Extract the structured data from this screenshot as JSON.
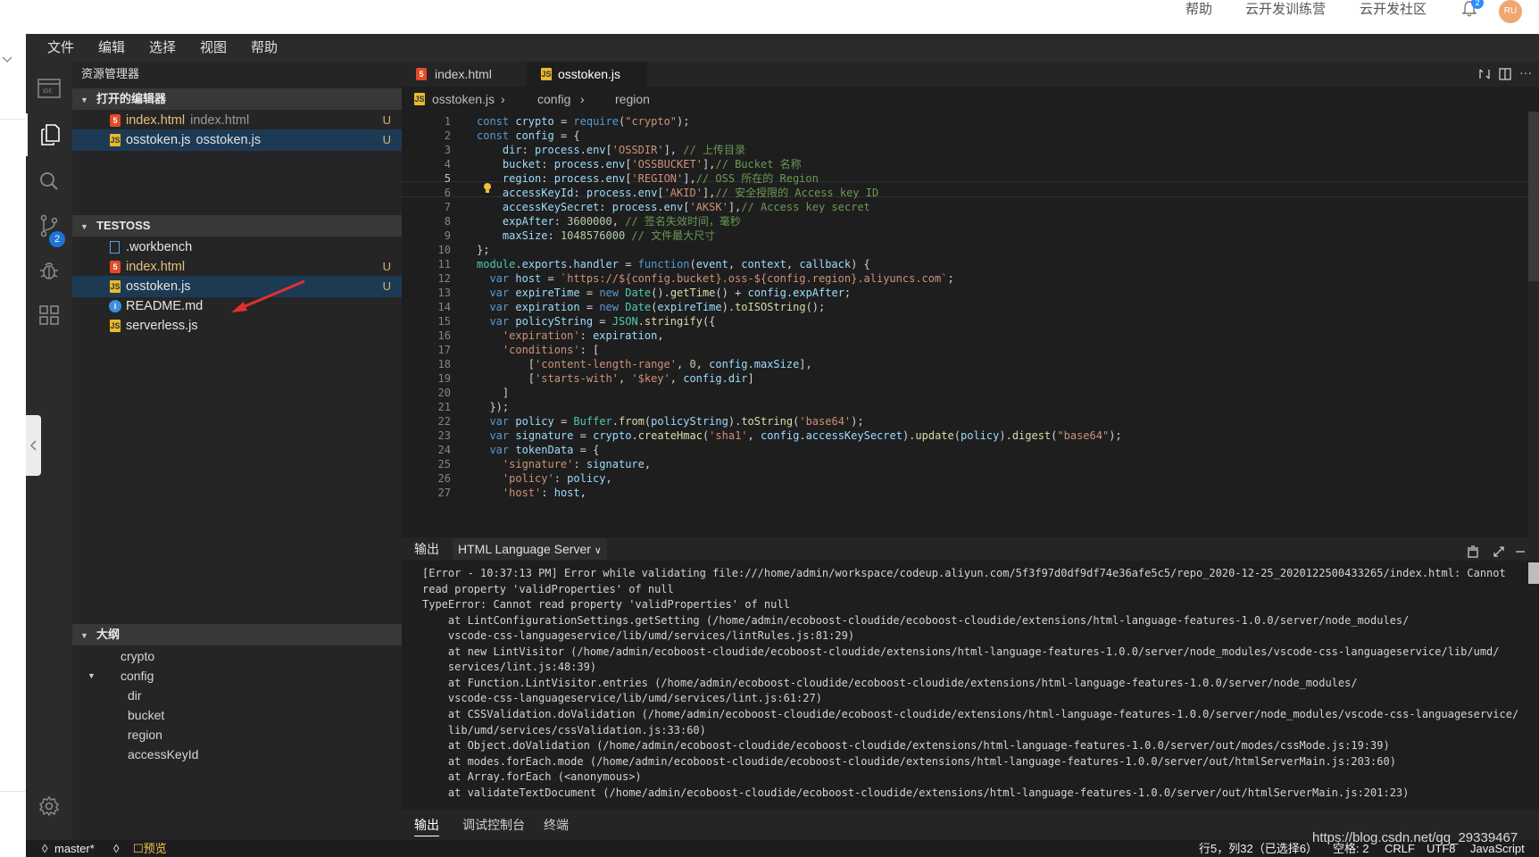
{
  "top_header": {
    "links": [
      "帮助",
      "云开发训练营",
      "云开发社区"
    ],
    "notification_count": "2",
    "avatar_initials": "RU"
  },
  "menubar": {
    "items": [
      "文件",
      "编辑",
      "选择",
      "视图",
      "帮助"
    ]
  },
  "activity_bar": {
    "icons": [
      "ide-logo-icon",
      "explorer-icon",
      "search-icon",
      "source-control-icon",
      "debug-icon",
      "extensions-icon",
      "settings-icon"
    ],
    "scm_badge": "2"
  },
  "sidebar": {
    "title": "资源管理器",
    "open_editors": {
      "header": "打开的编辑器",
      "items": [
        {
          "name": "index.html",
          "desc": "index.html",
          "badge": "U"
        },
        {
          "name": "osstoken.js",
          "desc": "osstoken.js",
          "badge": "U"
        }
      ]
    },
    "workspace": {
      "header": "TESTOSS",
      "items": [
        {
          "name": ".workbench",
          "badge": ""
        },
        {
          "name": "index.html",
          "badge": "U"
        },
        {
          "name": "osstoken.js",
          "badge": "U"
        },
        {
          "name": "README.md",
          "badge": ""
        },
        {
          "name": "serverless.js",
          "badge": ""
        }
      ]
    },
    "outline": {
      "header": "大纲",
      "items": [
        "crypto",
        "config",
        "dir",
        "bucket",
        "region",
        "accessKeyId"
      ]
    }
  },
  "editor": {
    "tabs": [
      "index.html",
      "osstoken.js"
    ],
    "active_tab": "osstoken.js",
    "breadcrumb": [
      "osstoken.js",
      "config",
      "region"
    ],
    "line_numbers": [
      "1",
      "2",
      "3",
      "4",
      "5",
      "6",
      "7",
      "8",
      "9",
      "10",
      "11",
      "12",
      "13",
      "14",
      "15",
      "16",
      "17",
      "18",
      "19",
      "20",
      "21",
      "22",
      "23",
      "24",
      "25",
      "26",
      "27"
    ],
    "code": [
      "const crypto = require(\"crypto\");",
      "const config = {",
      "    dir: process.env['OSSDIR'], // 上传目录",
      "    bucket: process.env['OSSBUCKET'],// Bucket 名称",
      "    region: process.env['REGION'],// OSS 所在的 Region",
      "    accessKeyId: process.env['AKID'],// 安全授限的 Access key ID",
      "    accessKeySecret: process.env['AKSK'],// Access key secret",
      "    expAfter: 3600000, // 签名失效时间，毫秒",
      "    maxSize: 1048576000 // 文件最大尺寸",
      "};",
      "module.exports.handler = function(event, context, callback) {",
      "  var host = `https://${config.bucket}.oss-${config.region}.aliyuncs.com`;",
      "  var expireTime = new Date().getTime() + config.expAfter;",
      "  var expiration = new Date(expireTime).toISOString();",
      "  var policyString = JSON.stringify({",
      "    'expiration': expiration,",
      "    'conditions': [",
      "        ['content-length-range', 0, config.maxSize],",
      "        ['starts-with', '$key', config.dir]",
      "    ]",
      "  });",
      "  var policy = Buffer.from(policyString).toString('base64');",
      "  var signature = crypto.createHmac('sha1', config.accessKeySecret).update(policy).digest(\"base64\");",
      "  var tokenData = {",
      "    'signature': signature,",
      "    'policy': policy,",
      "    'host': host,"
    ],
    "cursor_line": "5"
  },
  "panel": {
    "title": "输出",
    "channel": "HTML Language Server",
    "output_lines": [
      "[Error - 10:37:13 PM] Error while validating file:///home/admin/workspace/codeup.aliyun.com/5f3f97d0df9df74e36afe5c5/repo_2020-12-25_2020122500433265/index.html: Cannot",
      "read property 'validProperties' of null",
      "TypeError: Cannot read property 'validProperties' of null",
      "    at LintConfigurationSettings.getSetting (/home/admin/ecoboost-cloudide/ecoboost-cloudide/extensions/html-language-features-1.0.0/server/node_modules/",
      "    vscode-css-languageservice/lib/umd/services/lintRules.js:81:29)",
      "    at new LintVisitor (/home/admin/ecoboost-cloudide/ecoboost-cloudide/extensions/html-language-features-1.0.0/server/node_modules/vscode-css-languageservice/lib/umd/",
      "    services/lint.js:48:39)",
      "    at Function.LintVisitor.entries (/home/admin/ecoboost-cloudide/ecoboost-cloudide/extensions/html-language-features-1.0.0/server/node_modules/",
      "    vscode-css-languageservice/lib/umd/services/lint.js:61:27)",
      "    at CSSValidation.doValidation (/home/admin/ecoboost-cloudide/ecoboost-cloudide/extensions/html-language-features-1.0.0/server/node_modules/vscode-css-languageservice/",
      "    lib/umd/services/cssValidation.js:33:60)",
      "    at Object.doValidation (/home/admin/ecoboost-cloudide/ecoboost-cloudide/extensions/html-language-features-1.0.0/server/out/modes/cssMode.js:19:39)",
      "    at modes.forEach.mode (/home/admin/ecoboost-cloudide/ecoboost-cloudide/extensions/html-language-features-1.0.0/server/out/htmlServerMain.js:203:60)",
      "    at Array.forEach (<anonymous>)",
      "    at validateTextDocument (/home/admin/ecoboost-cloudide/ecoboost-cloudide/extensions/html-language-features-1.0.0/server/out/htmlServerMain.js:201:23)"
    ],
    "bottom_tabs": [
      "输出",
      "调试控制台",
      "终端"
    ]
  },
  "status_bar": {
    "branch": "master*",
    "preview": "预览",
    "position": "行5，列32（已选择6）",
    "indent": "空格: 2",
    "eol": "CRLF",
    "encoding": "UTF8",
    "language": "JavaScript"
  },
  "watermark": "https://blog.csdn.net/qq_29339467",
  "colors": {
    "background": "#1e1e1e",
    "sidebar": "#252526",
    "selected_row": "#1d3a54",
    "badge_blue": "#1d74d8",
    "annotation_arrow": "#e03030"
  }
}
